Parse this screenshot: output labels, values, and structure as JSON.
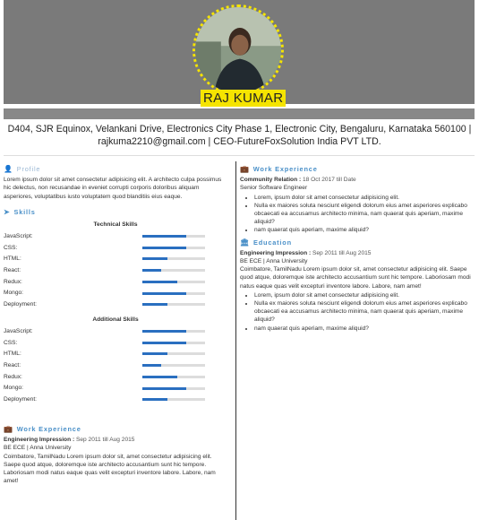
{
  "header": {
    "name": "RAJ KUMAR",
    "address": "D404, SJR Equinox, Velankani Drive, Electronics City Phase 1, Electronic City, Bengaluru, Karnataka 560100 |",
    "contact": "rajkuma2210@gmail.com | CEO-FutureFoxSolution India PVT LTD."
  },
  "profile": {
    "title": "Profile",
    "text": "Lorem ipsum dolor sit amet consectetur adipisicing elit. A architecto culpa possimus hic delectus, non recusandae in eveniet corrupti corporis doloribus aliquam asperiores, voluptatibus iusto voluptatem quod blanditiis eius eaque."
  },
  "skills": {
    "title": "Skills",
    "groups": [
      {
        "title": "Technical Skills",
        "items": [
          {
            "label": "JavaScript:",
            "level": 0.7
          },
          {
            "label": "CSS:",
            "level": 0.7
          },
          {
            "label": "HTML:",
            "level": 0.4
          },
          {
            "label": "React:",
            "level": 0.3
          },
          {
            "label": "Redux:",
            "level": 0.55
          },
          {
            "label": "Mongo:",
            "level": 0.7
          },
          {
            "label": "Deployment:",
            "level": 0.4
          }
        ]
      },
      {
        "title": "Additional Skills",
        "items": [
          {
            "label": "JavaScript:",
            "level": 0.7
          },
          {
            "label": "CSS:",
            "level": 0.7
          },
          {
            "label": "HTML:",
            "level": 0.4
          },
          {
            "label": "React:",
            "level": 0.3
          },
          {
            "label": "Redux:",
            "level": 0.55
          },
          {
            "label": "Mongo:",
            "level": 0.7
          },
          {
            "label": "Deployment:",
            "level": 0.4
          }
        ]
      }
    ]
  },
  "left_work": {
    "title": "Work Experience",
    "org": "Engineering Impression :",
    "dates": " Sep 2011 till Aug 2015",
    "degree": "BE ECE | Anna University",
    "text": "Coimbatore, TamilNadu Lorem ipsum dolor sit, amet consectetur adipisicing elit. Saepe quod atque, doloremque iste architecto accusantium sunt hic tempore. Laboriosam modi natus eaque quas velit excepturi inventore labore. Labore, nam amet!"
  },
  "work": {
    "title": "Work Experience",
    "org": "Community Relation :",
    "dates": " 18 Oct 2017 till Date",
    "role": "Senior Software Engineer",
    "bullets": [
      "Lorem, ipsum dolor sit amet consectetur adipisicing elit.",
      "Nulla ex maiores soluta nesciunt eligendi dolorum eius amet asperiores explicabo obcaecati ea accusamus architecto minima, nam quaerat quis aperiam, maxime aliquid?",
      "nam quaerat quis aperiam, maxime aliquid?"
    ]
  },
  "education": {
    "title": "Education",
    "org": "Engineering Impression :",
    "dates": " Sep 2011 till Aug 2015",
    "degree": "BE ECE | Anna University",
    "text": "Coimbatore, TamilNadu Lorem ipsum dolor sit, amet consectetur adipisicing elit. Saepe quod atque, doloremque iste architecto accusantium sunt hic tempore. Laboriosam modi natus eaque quas velit excepturi inventore labore. Labore, nam amet!",
    "bullets": [
      "Lorem, ipsum dolor sit amet consectetur adipisicing elit.",
      "Nulla ex maiores soluta nesciunt eligendi dolorum eius amet asperiores explicabo obcaecati ea accusamus architecto minima, nam quaerat quis aperiam, maxime aliquid?",
      "nam quaerat quis aperiam, maxime aliquid?"
    ]
  },
  "colors": {
    "accent": "#4a90c8",
    "bar": "#2a6fc0",
    "highlight": "#f5e400",
    "banner": "#7a7a7a"
  }
}
